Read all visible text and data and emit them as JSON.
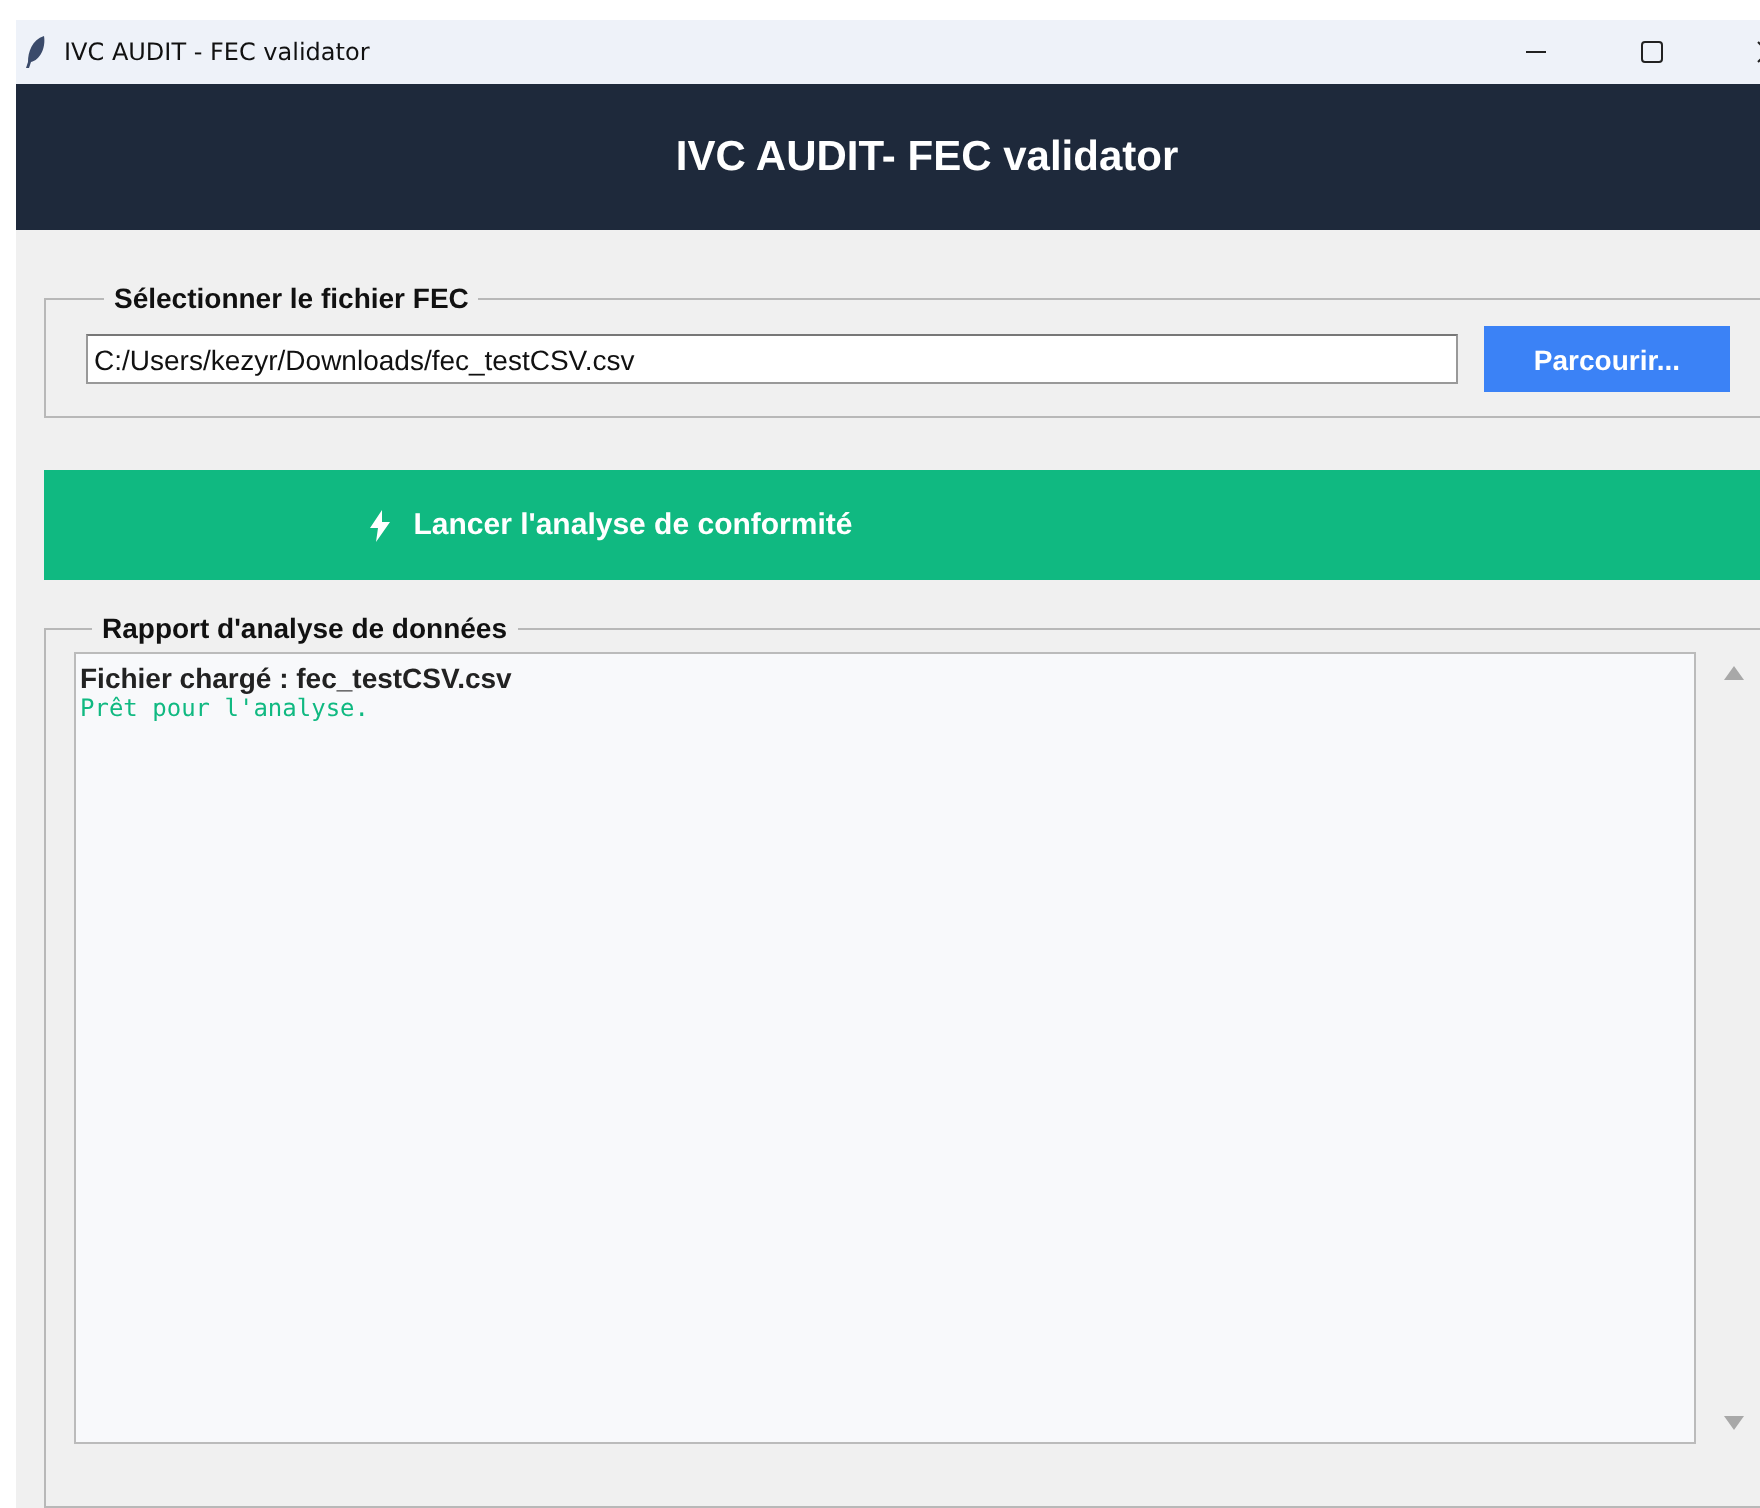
{
  "window": {
    "title": "IVC AUDIT - FEC validator"
  },
  "header": {
    "title": "IVC AUDIT- FEC validator"
  },
  "file_section": {
    "legend": "Sélectionner le fichier FEC",
    "path_value": "C:/Users/kezyr/Downloads/fec_testCSV.csv",
    "browse_button": "Parcourir..."
  },
  "analyze_button": {
    "label": "Lancer l'analyse de conformité"
  },
  "report_section": {
    "legend": "Rapport d'analyse de données",
    "lines": [
      {
        "kind": "heading",
        "text": "Fichier chargé : fec_testCSV.csv"
      },
      {
        "kind": "success",
        "text": "Prêt pour l'analyse."
      }
    ]
  }
}
